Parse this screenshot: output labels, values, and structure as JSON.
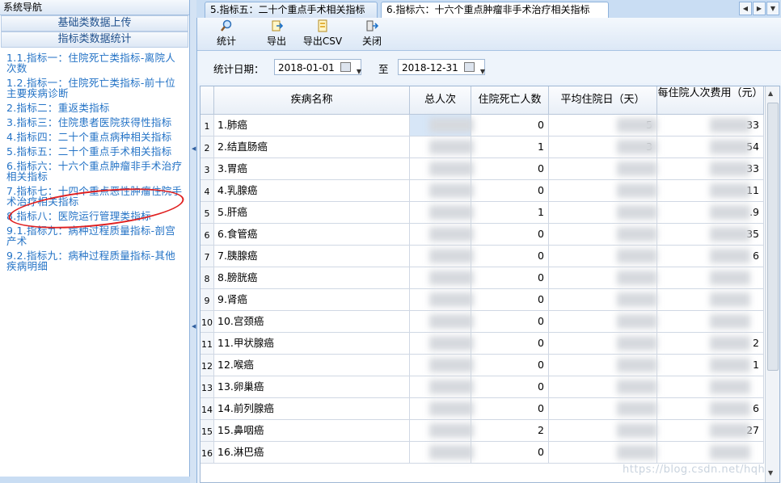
{
  "nav": {
    "header": "系统导航",
    "sections": [
      "基础类数据上传",
      "指标类数据统计"
    ],
    "items": [
      "1.1.指标一：住院死亡类指标-离院人次数",
      "1.2.指标一：住院死亡类指标-前十位主要疾病诊断",
      "2.指标二：重返类指标",
      "3.指标三：住院患者医院获得性指标",
      "4.指标四：二十个重点病种相关指标",
      "5.指标五：二十个重点手术相关指标",
      "6.指标六：十六个重点肿瘤非手术治疗相关指标",
      "7.指标七：十四个重点恶性肿瘤住院手术治疗相关指标",
      "8.指标八：医院运行管理类指标",
      "9.1.指标九：病种过程质量指标-剖宫产术",
      "9.2.指标九：病种过程质量指标-其他疾病明细"
    ]
  },
  "tabs": [
    {
      "label": "5.指标五：二十个重点手术相关指标",
      "active": false
    },
    {
      "label": "6.指标六：十六个重点肿瘤非手术治疗相关指标",
      "active": true,
      "close": "✕"
    }
  ],
  "toolbar": {
    "stat": "统计",
    "export": "导出",
    "export_csv": "导出CSV",
    "close": "关闭"
  },
  "filters": {
    "label": "统计日期：",
    "start": "2018-01-01",
    "to": "至",
    "end": "2018-12-31"
  },
  "grid": {
    "columns": [
      "疾病名称",
      "总人次",
      "住院死亡人数",
      "平均住院日（天）",
      "每住院人次费用（元）"
    ],
    "rows": [
      {
        "n": "1",
        "name": "1.肺癌",
        "deaths": "0",
        "days": "5",
        "cost": "33"
      },
      {
        "n": "2",
        "name": "2.结直肠癌",
        "deaths": "1",
        "days": "3",
        "cost": "54"
      },
      {
        "n": "3",
        "name": "3.胃癌",
        "deaths": "0",
        "days": "",
        "cost": "33"
      },
      {
        "n": "4",
        "name": "4.乳腺癌",
        "deaths": "0",
        "days": "",
        "cost": "11"
      },
      {
        "n": "5",
        "name": "5.肝癌",
        "deaths": "1",
        "days": "",
        "cost": ".9"
      },
      {
        "n": "6",
        "name": "6.食管癌",
        "deaths": "0",
        "days": "",
        "cost": "35"
      },
      {
        "n": "7",
        "name": "7.胰腺癌",
        "deaths": "0",
        "days": "",
        "cost": "6"
      },
      {
        "n": "8",
        "name": "8.膀胱癌",
        "deaths": "0",
        "days": "",
        "cost": ""
      },
      {
        "n": "9",
        "name": "9.肾癌",
        "deaths": "0",
        "days": "",
        "cost": ""
      },
      {
        "n": "10",
        "name": "10.宫颈癌",
        "deaths": "0",
        "days": "",
        "cost": ""
      },
      {
        "n": "11",
        "name": "11.甲状腺癌",
        "deaths": "0",
        "days": "",
        "cost": "2"
      },
      {
        "n": "12",
        "name": "12.喉癌",
        "deaths": "0",
        "days": "",
        "cost": "1"
      },
      {
        "n": "13",
        "name": "13.卵巢癌",
        "deaths": "0",
        "days": "",
        "cost": ""
      },
      {
        "n": "14",
        "name": "14.前列腺癌",
        "deaths": "0",
        "days": "",
        "cost": "6"
      },
      {
        "n": "15",
        "name": "15.鼻咽癌",
        "deaths": "2",
        "days": "",
        "cost": "27"
      },
      {
        "n": "16",
        "name": "16.淋巴癌",
        "deaths": "0",
        "days": "",
        "cost": ""
      }
    ]
  },
  "watermark": "https://blog.csdn.net/hqh"
}
